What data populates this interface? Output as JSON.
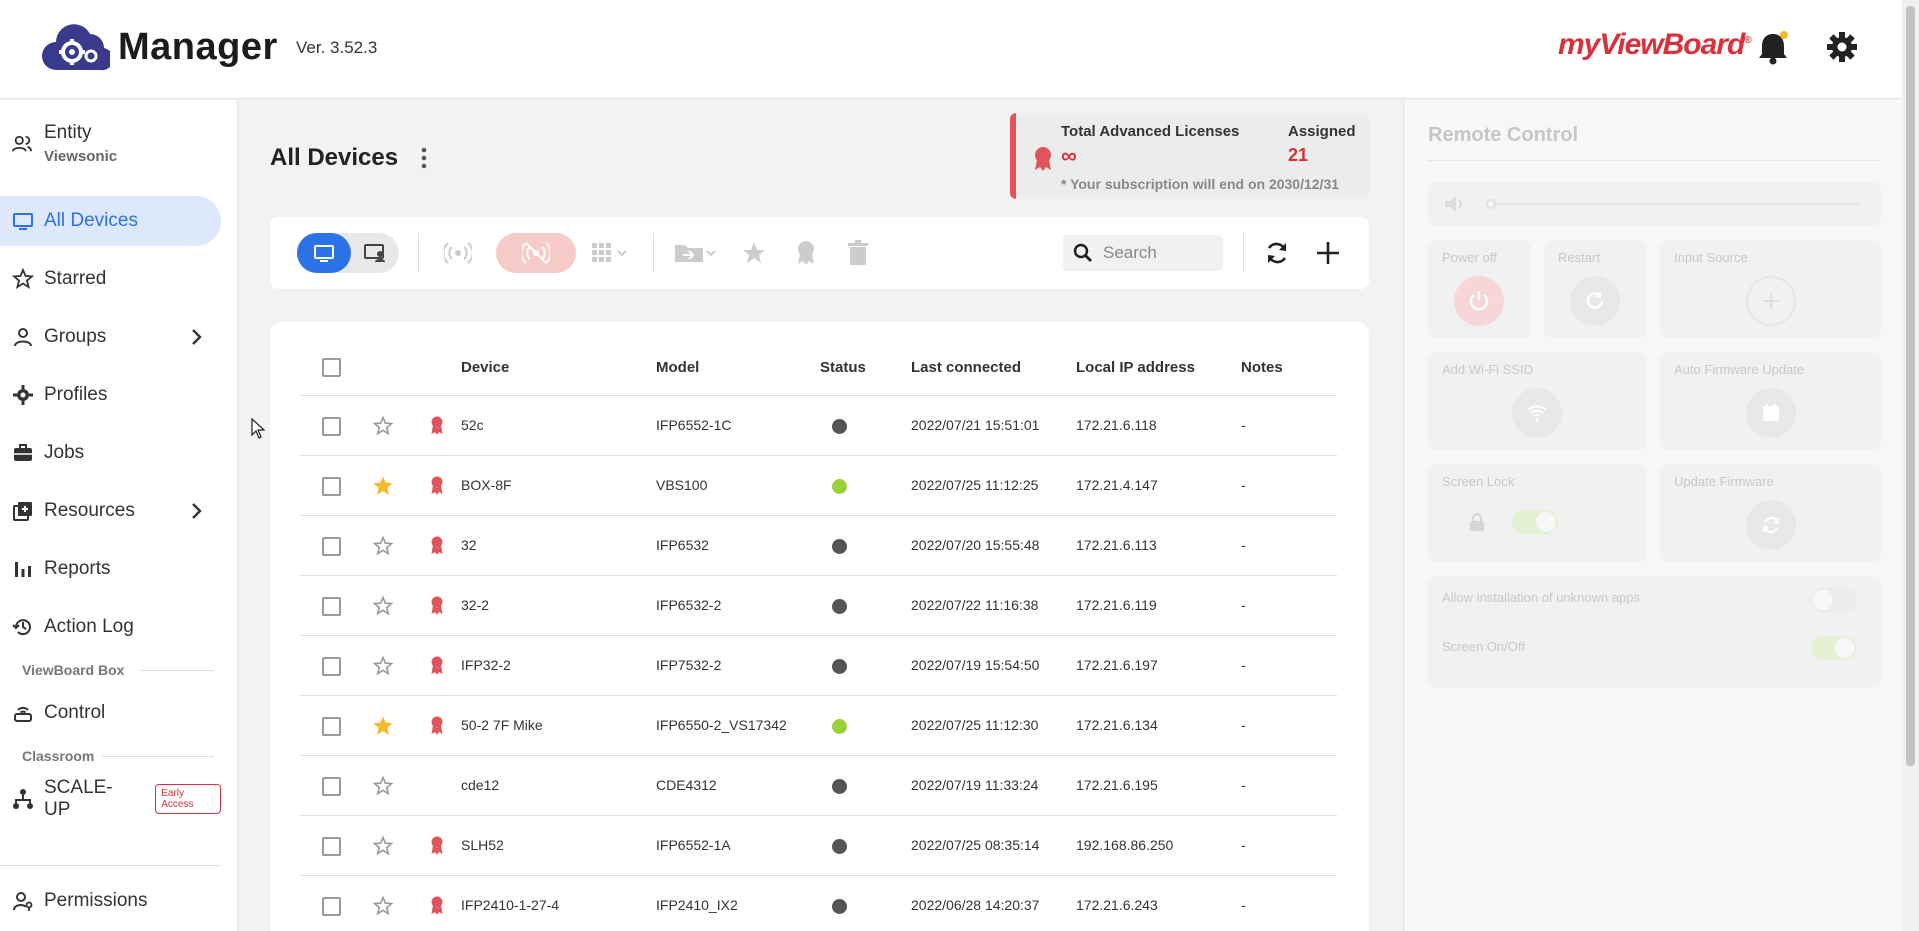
{
  "header": {
    "app_name": "Manager",
    "version": "Ver. 3.52.3",
    "brand": "myViewBoard",
    "brand_mark": "®"
  },
  "sidebar": {
    "entity": {
      "label": "Entity",
      "sub": "Viewsonic"
    },
    "items": [
      {
        "label": "All Devices",
        "icon": "monitor-icon",
        "active": true
      },
      {
        "label": "Starred",
        "icon": "star-icon"
      },
      {
        "label": "Groups",
        "icon": "users-icon"
      },
      {
        "label": "Profiles",
        "icon": "gear-icon"
      },
      {
        "label": "Jobs",
        "icon": "briefcase-icon"
      },
      {
        "label": "Resources",
        "icon": "resources-icon"
      },
      {
        "label": "Reports",
        "icon": "bar-chart-icon"
      },
      {
        "label": "Action Log",
        "icon": "history-icon"
      }
    ],
    "viewboard_box_label": "ViewBoard Box",
    "control_label": "Control",
    "classroom_label": "Classroom",
    "scaleup_label": "SCALE-UP",
    "early_access_label": "Early Access",
    "permissions_label": "Permissions"
  },
  "main": {
    "title": "All Devices",
    "license": {
      "total_label": "Total Advanced Licenses",
      "total_value": "∞",
      "assigned_label": "Assigned",
      "assigned_value": "21",
      "note": "* Your subscription will end on 2030/12/31"
    },
    "search_placeholder": "Search",
    "columns": [
      "Device",
      "Model",
      "Status",
      "Last connected",
      "Local IP address",
      "Notes"
    ],
    "rows": [
      {
        "starred": false,
        "licensed": true,
        "device": "52c",
        "model": "IFP6552-1C",
        "status": "offline",
        "last": "2022/07/21 15:51:01",
        "ip": "172.21.6.118",
        "notes": "-"
      },
      {
        "starred": true,
        "licensed": true,
        "device": "BOX-8F",
        "model": "VBS100",
        "status": "online",
        "last": "2022/07/25 11:12:25",
        "ip": "172.21.4.147",
        "notes": "-"
      },
      {
        "starred": false,
        "licensed": true,
        "device": "32",
        "model": "IFP6532",
        "status": "offline",
        "last": "2022/07/20 15:55:48",
        "ip": "172.21.6.113",
        "notes": "-"
      },
      {
        "starred": false,
        "licensed": true,
        "device": "32-2",
        "model": "IFP6532-2",
        "status": "offline",
        "last": "2022/07/22 11:16:38",
        "ip": "172.21.6.119",
        "notes": "-"
      },
      {
        "starred": false,
        "licensed": true,
        "device": "IFP32-2",
        "model": "IFP7532-2",
        "status": "offline",
        "last": "2022/07/19 15:54:50",
        "ip": "172.21.6.197",
        "notes": "-"
      },
      {
        "starred": true,
        "licensed": true,
        "device": "50-2 7F Mike",
        "model": "IFP6550-2_VS17342",
        "status": "online",
        "last": "2022/07/25 11:12:30",
        "ip": "172.21.6.134",
        "notes": "-"
      },
      {
        "starred": false,
        "licensed": false,
        "device": "cde12",
        "model": "CDE4312",
        "status": "offline",
        "last": "2022/07/19 11:33:24",
        "ip": "172.21.6.195",
        "notes": "-"
      },
      {
        "starred": false,
        "licensed": true,
        "device": "SLH52",
        "model": "IFP6552-1A",
        "status": "offline",
        "last": "2022/07/25 08:35:14",
        "ip": "192.168.86.250",
        "notes": "-"
      },
      {
        "starred": false,
        "licensed": true,
        "device": "IFP2410-1-27-4",
        "model": "IFP2410_IX2",
        "status": "offline",
        "last": "2022/06/28 14:20:37",
        "ip": "172.21.6.243",
        "notes": "-"
      }
    ]
  },
  "remote": {
    "title": "Remote Control",
    "power_off": "Power off",
    "restart": "Restart",
    "input_source": "Input Source",
    "add_wifi": "Add Wi-Fi SSID",
    "auto_fw": "Auto Firmware Update",
    "screen_lock": "Screen Lock",
    "update_fw": "Update Firmware",
    "allow_unknown": "Allow installation of unknown apps",
    "screen_onoff": "Screen On/Off"
  },
  "colors": {
    "accent": "#2a72e6",
    "brand_red": "#d9303a",
    "status_online": "#9dcf3b",
    "status_offline": "#555555",
    "star_gold": "#f5b82e"
  }
}
